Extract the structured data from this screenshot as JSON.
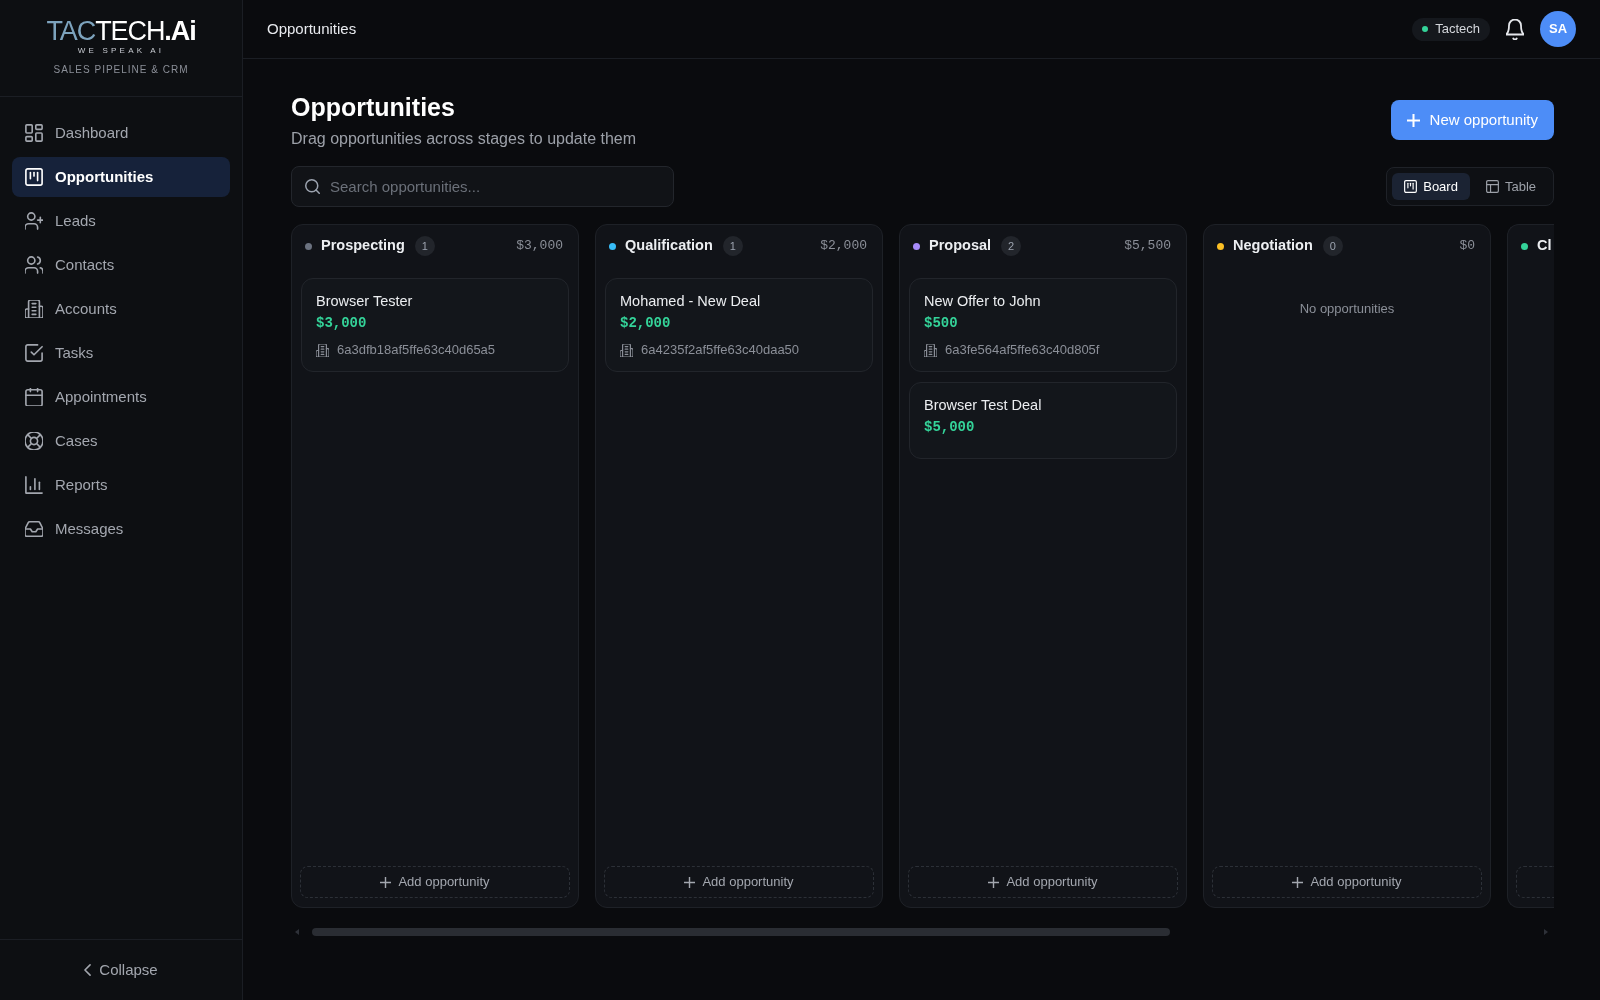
{
  "sidebar": {
    "logo": {
      "part_1": "TAC",
      "part_2": "TECH",
      "part_3": ".Ai",
      "tagline": "WE SPEAK AI"
    },
    "subtitle": "SALES PIPELINE & CRM",
    "items": [
      {
        "label": "Dashboard",
        "selected": false
      },
      {
        "label": "Opportunities",
        "selected": true
      },
      {
        "label": "Leads",
        "selected": false
      },
      {
        "label": "Contacts",
        "selected": false
      },
      {
        "label": "Accounts",
        "selected": false
      },
      {
        "label": "Tasks",
        "selected": false
      },
      {
        "label": "Appointments",
        "selected": false
      },
      {
        "label": "Cases",
        "selected": false
      },
      {
        "label": "Reports",
        "selected": false
      },
      {
        "label": "Messages",
        "selected": false
      }
    ],
    "collapse": "Collapse"
  },
  "header": {
    "title": "Opportunities",
    "workspace": "Tactech",
    "avatar": "SA"
  },
  "page": {
    "title": "Opportunities",
    "subtitle": "Drag opportunities across stages to update them",
    "new_button": "New opportunity",
    "search": {
      "placeholder": "Search opportunities..."
    },
    "views": [
      {
        "label": "Board",
        "selected": true
      },
      {
        "label": "Table",
        "selected": false
      }
    ]
  },
  "board": {
    "columns": [
      {
        "kind": "stage",
        "name": "Prospecting",
        "color": "#6b7280",
        "count": "1",
        "total": "$3,000",
        "cards": [
          {
            "title": "Browser Tester",
            "amount": "$3,000",
            "account": "6a3dfb18af5ffe63c40d65a5"
          }
        ],
        "add_label": "Add opportunity"
      },
      {
        "kind": "stage",
        "name": "Qualification",
        "color": "#38bdf8",
        "count": "1",
        "total": "$2,000",
        "cards": [
          {
            "title": "Mohamed - New Deal",
            "amount": "$2,000",
            "account": "6a4235f2af5ffe63c40daa50"
          }
        ],
        "add_label": "Add opportunity"
      },
      {
        "kind": "stage",
        "name": "Proposal",
        "color": "#a78bfa",
        "count": "2",
        "total": "$5,500",
        "cards": [
          {
            "title": "New Offer to John",
            "amount": "$500",
            "account": "6a3fe564af5ffe63c40d805f"
          },
          {
            "title": "Browser Test Deal",
            "amount": "$5,000"
          }
        ],
        "add_label": "Add opportunity"
      },
      {
        "kind": "stage",
        "name": "Negotiation",
        "color": "#fbbf24",
        "count": "0",
        "total": "$0",
        "empty_text": "No opportunities",
        "add_label": "Add opportunity"
      },
      {
        "kind": "clipped",
        "name": "Cl",
        "color": "#34d399"
      }
    ]
  }
}
